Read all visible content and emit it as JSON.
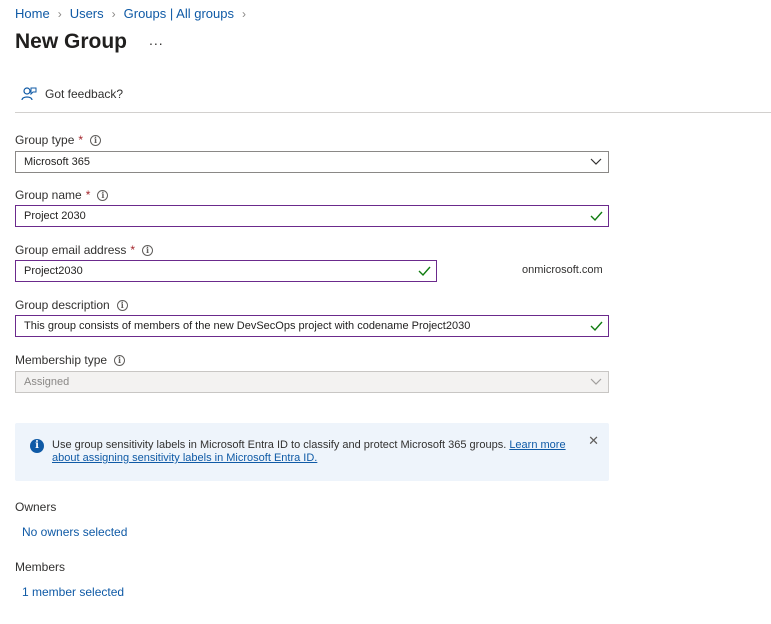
{
  "breadcrumb": {
    "items": [
      "Home",
      "Users",
      "Groups | All groups"
    ]
  },
  "header": {
    "title": "New Group",
    "more_label": "..."
  },
  "commandbar": {
    "feedback_label": "Got feedback?"
  },
  "form": {
    "group_type": {
      "label": "Group type",
      "required_mark": "*",
      "value": "Microsoft 365"
    },
    "group_name": {
      "label": "Group name",
      "required_mark": "*",
      "value": "Project 2030"
    },
    "group_email": {
      "label": "Group email address",
      "required_mark": "*",
      "value": "Project2030",
      "domain": "onmicrosoft.com"
    },
    "group_description": {
      "label": "Group description",
      "value": "This group consists of members of the new DevSecOps project with codename Project2030"
    },
    "membership_type": {
      "label": "Membership type",
      "value": "Assigned"
    }
  },
  "info_banner": {
    "message": "Use group sensitivity labels in Microsoft Entra ID to classify and protect Microsoft 365 groups.",
    "link_text": "Learn more about assigning sensitivity labels in Microsoft Entra ID.",
    "close_label": "✕"
  },
  "owners": {
    "label": "Owners",
    "link": "No owners selected"
  },
  "members": {
    "label": "Members",
    "link": "1 member selected"
  },
  "colors": {
    "link": "#0f5aa6",
    "valid_border": "#6b2a8c",
    "valid_check": "#107c10",
    "required": "#a4262c",
    "info_bg": "#eef4fb"
  },
  "icons": {
    "feedback": "feedback-person-icon",
    "info": "info-icon",
    "check": "checkmark-icon",
    "chevron": "chevron-down-icon",
    "close": "close-icon"
  }
}
